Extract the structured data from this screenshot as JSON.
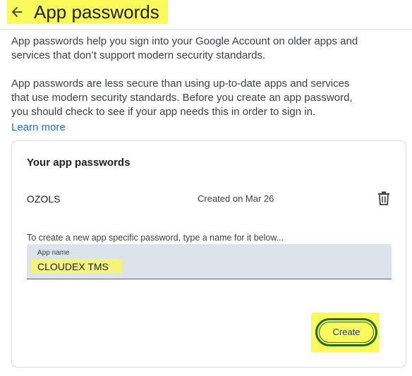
{
  "header": {
    "back_icon": "arrow-left-icon",
    "title": "App passwords"
  },
  "intro": {
    "paragraph1": "App passwords help you sign into your Google Account on older apps and services that don’t support modern security standards.",
    "paragraph2": "App passwords are less secure than using up-to-date apps and services that use modern security standards. Before you create an app password, you should check to see if your app needs this in order to sign in.",
    "learn_more": "Learn more"
  },
  "card": {
    "title": "Your app passwords",
    "passwords": [
      {
        "name": "OZOLS",
        "created": "Created on Mar 26",
        "delete_icon": "trash-icon"
      }
    ],
    "instruction": "To create a new app specific password, type a name for it below...",
    "app_name_field": {
      "label": "App name",
      "value": "CLOUDEX TMS"
    },
    "create_label": "Create"
  },
  "colors": {
    "highlight": "#fafa5a",
    "link": "#1a73e8",
    "button_border": "#1e6b2c",
    "field_bg": "#dde3ea"
  }
}
